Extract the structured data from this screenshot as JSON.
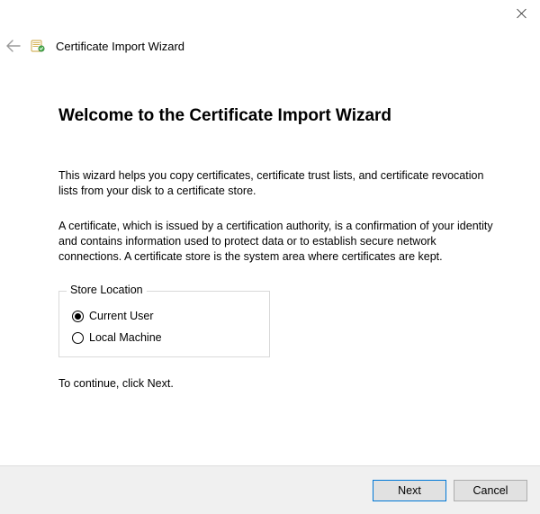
{
  "window": {
    "title": "Certificate Import Wizard"
  },
  "page": {
    "heading": "Welcome to the Certificate Import Wizard",
    "intro1": "This wizard helps you copy certificates, certificate trust lists, and certificate revocation lists from your disk to a certificate store.",
    "intro2": "A certificate, which is issued by a certification authority, is a confirmation of your identity and contains information used to protect data or to establish secure network connections. A certificate store is the system area where certificates are kept.",
    "continue_text": "To continue, click Next."
  },
  "store_location": {
    "legend": "Store Location",
    "options": {
      "current_user": "Current User",
      "local_machine": "Local Machine"
    },
    "selected": "current_user"
  },
  "buttons": {
    "next": "Next",
    "cancel": "Cancel"
  }
}
